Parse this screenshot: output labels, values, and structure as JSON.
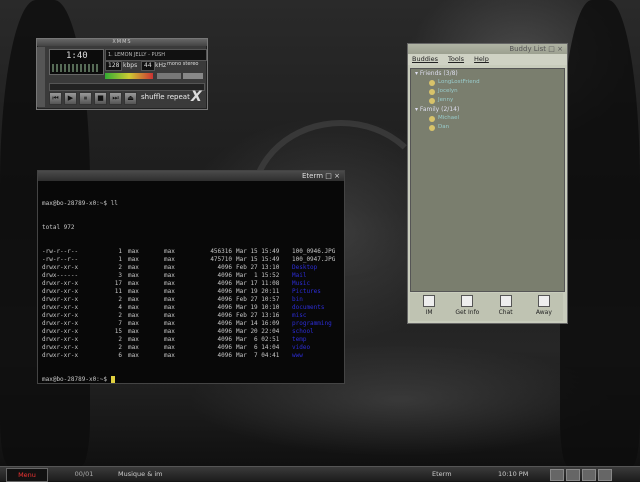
{
  "xmms": {
    "song_title": "1. LEMON JELLY - PUSH",
    "time": "1:40",
    "kbps_value": "128",
    "kbps_label": "kbps",
    "khz_value": "44",
    "khz_label": "kHz",
    "mono_label": "mono",
    "stereo_label": "stereo",
    "shuffle_label": "shuffle",
    "repeat_label": "repeat",
    "logo_glyph": "X"
  },
  "eterm": {
    "title": "Eterm",
    "prompt": "max@bo-28789-x0:~$",
    "command": "ll",
    "total_line": "total 972",
    "rows": [
      {
        "perm": "-rw-r--r--",
        "links": "1",
        "owner": "max",
        "group": "max",
        "size": "456316",
        "date": "Mar 15 15:49",
        "name": "100_0946.JPG",
        "dir": false
      },
      {
        "perm": "-rw-r--r--",
        "links": "1",
        "owner": "max",
        "group": "max",
        "size": "475710",
        "date": "Mar 15 15:49",
        "name": "100_0947.JPG",
        "dir": false
      },
      {
        "perm": "drwxr-xr-x",
        "links": "2",
        "owner": "max",
        "group": "max",
        "size": "4096",
        "date": "Feb 27 13:10",
        "name": "Desktop",
        "dir": true
      },
      {
        "perm": "drwx------",
        "links": "3",
        "owner": "max",
        "group": "max",
        "size": "4096",
        "date": "Mar  1 15:52",
        "name": "Mail",
        "dir": true
      },
      {
        "perm": "drwxr-xr-x",
        "links": "17",
        "owner": "max",
        "group": "max",
        "size": "4096",
        "date": "Mar 17 11:08",
        "name": "Music",
        "dir": true
      },
      {
        "perm": "drwxr-xr-x",
        "links": "11",
        "owner": "max",
        "group": "max",
        "size": "4096",
        "date": "Mar 19 20:11",
        "name": "Pictures",
        "dir": true
      },
      {
        "perm": "drwxr-xr-x",
        "links": "2",
        "owner": "max",
        "group": "max",
        "size": "4096",
        "date": "Feb 27 10:57",
        "name": "bin",
        "dir": true
      },
      {
        "perm": "drwxr-xr-x",
        "links": "4",
        "owner": "max",
        "group": "max",
        "size": "4096",
        "date": "Mar 19 10:10",
        "name": "documents",
        "dir": true
      },
      {
        "perm": "drwxr-xr-x",
        "links": "2",
        "owner": "max",
        "group": "max",
        "size": "4096",
        "date": "Feb 27 13:16",
        "name": "misc",
        "dir": true
      },
      {
        "perm": "drwxr-xr-x",
        "links": "7",
        "owner": "max",
        "group": "max",
        "size": "4096",
        "date": "Mar 14 16:09",
        "name": "programming",
        "dir": true
      },
      {
        "perm": "drwxr-xr-x",
        "links": "15",
        "owner": "max",
        "group": "max",
        "size": "4096",
        "date": "Mar 20 22:04",
        "name": "school",
        "dir": true
      },
      {
        "perm": "drwxr-xr-x",
        "links": "2",
        "owner": "max",
        "group": "max",
        "size": "4096",
        "date": "Mar  6 02:51",
        "name": "temp",
        "dir": true
      },
      {
        "perm": "drwxr-xr-x",
        "links": "2",
        "owner": "max",
        "group": "max",
        "size": "4096",
        "date": "Mar  6 14:04",
        "name": "video",
        "dir": true
      },
      {
        "perm": "drwxr-xr-x",
        "links": "6",
        "owner": "max",
        "group": "max",
        "size": "4096",
        "date": "Mar  7 04:41",
        "name": "www",
        "dir": true
      }
    ]
  },
  "buddy": {
    "title": "Buddy List",
    "menu": [
      "Buddies",
      "Tools",
      "Help"
    ],
    "groups": [
      {
        "name": "Friends (3/8)",
        "members": [
          "LongLostFriend",
          "Jocelyn",
          "Jenny"
        ]
      },
      {
        "name": "Family (2/14)",
        "members": [
          "Michael",
          "Dan"
        ]
      }
    ],
    "buttons": [
      "IM",
      "Get Info",
      "Chat",
      "Away"
    ]
  },
  "taskbar": {
    "menu_label": "Menu",
    "pager": "00/01",
    "task1": "Musique & im",
    "task2": "Eterm",
    "clock": "10:10 PM"
  }
}
